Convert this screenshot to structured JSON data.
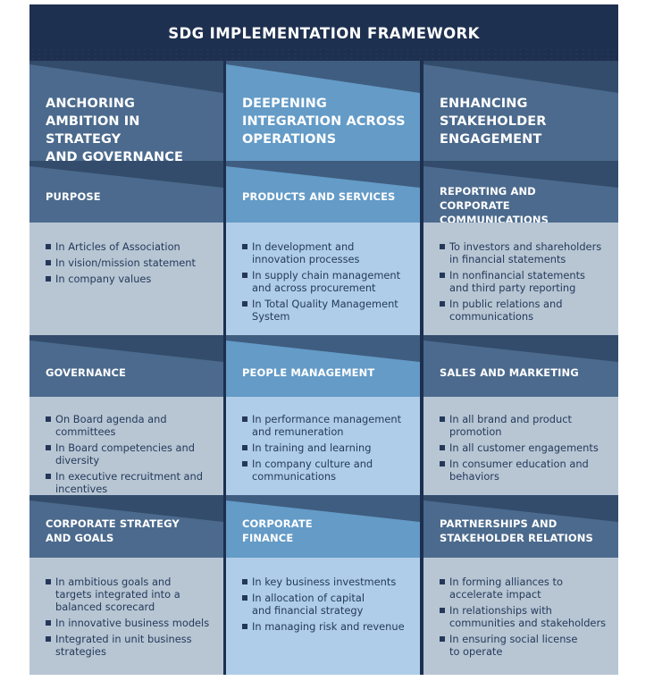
{
  "title": "SDG IMPLEMENTATION FRAMEWORK",
  "columns": [
    {
      "heading": [
        "ANCHORING",
        "AMBITION IN STRATEGY",
        "AND GOVERNANCE"
      ],
      "sections": [
        {
          "title": [
            "PURPOSE"
          ],
          "items": [
            [
              "In Articles of Association"
            ],
            [
              "In vision/mission statement"
            ],
            [
              "In company values"
            ]
          ]
        },
        {
          "title": [
            "GOVERNANCE"
          ],
          "items": [
            [
              "On Board agenda and committees"
            ],
            [
              "In Board competencies and",
              "diversity"
            ],
            [
              "In executive recruitment and",
              "incentives"
            ]
          ]
        },
        {
          "title": [
            "CORPORATE STRATEGY",
            "AND GOALS"
          ],
          "items": [
            [
              "In ambitious goals and",
              "targets integrated into a",
              "balanced scorecard"
            ],
            [
              "In innovative business models"
            ],
            [
              "Integrated in unit business",
              "strategies"
            ]
          ]
        }
      ]
    },
    {
      "heading": [
        "DEEPENING",
        "INTEGRATION ACROSS",
        "OPERATIONS"
      ],
      "sections": [
        {
          "title": [
            "PRODUCTS AND SERVICES"
          ],
          "items": [
            [
              "In development and",
              "innovation processes"
            ],
            [
              "In supply chain management",
              "and across procurement"
            ],
            [
              "In Total Quality Management",
              "System"
            ]
          ]
        },
        {
          "title": [
            "PEOPLE MANAGEMENT"
          ],
          "items": [
            [
              "In performance management",
              "and remuneration"
            ],
            [
              "In training and learning"
            ],
            [
              "In company culture and",
              "communications"
            ]
          ]
        },
        {
          "title": [
            "CORPORATE",
            "FINANCE"
          ],
          "items": [
            [
              "In key business investments"
            ],
            [
              "In allocation of capital",
              "and financial strategy"
            ],
            [
              "In managing risk and revenue"
            ]
          ]
        }
      ]
    },
    {
      "heading": [
        "ENHANCING",
        "STAKEHOLDER",
        "ENGAGEMENT"
      ],
      "sections": [
        {
          "title": [
            "REPORTING AND",
            "CORPORATE COMMUNICATIONS"
          ],
          "items": [
            [
              "To investors and shareholders",
              "in financial statements"
            ],
            [
              "In nonfinancial statements",
              "and third party reporting"
            ],
            [
              "In public relations and",
              "communications"
            ]
          ]
        },
        {
          "title": [
            "SALES AND MARKETING"
          ],
          "items": [
            [
              "In all brand and product",
              "promotion"
            ],
            [
              "In all customer engagements"
            ],
            [
              "In consumer education and",
              "behaviors"
            ]
          ]
        },
        {
          "title": [
            "PARTNERSHIPS AND",
            "STAKEHOLDER RELATIONS"
          ],
          "items": [
            [
              "In forming alliances to",
              "accelerate impact"
            ],
            [
              "In relationships with",
              "communities and stakeholders"
            ],
            [
              "In ensuring social license",
              "to operate"
            ]
          ]
        }
      ]
    }
  ]
}
